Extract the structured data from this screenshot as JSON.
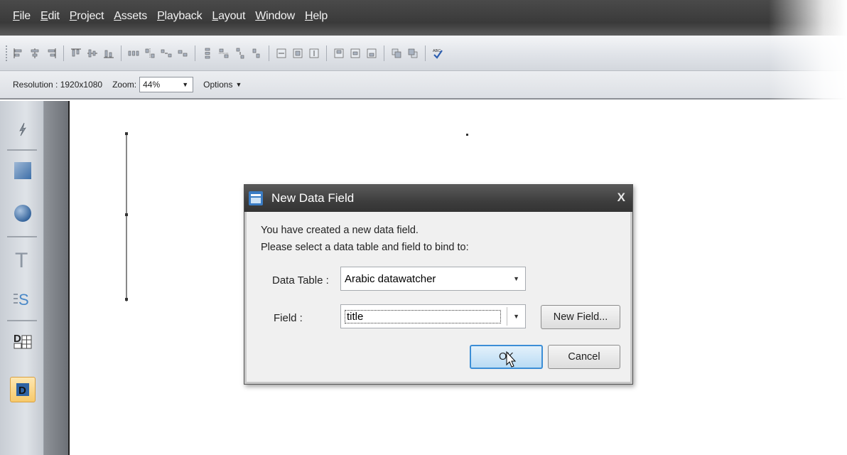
{
  "menu": {
    "items": [
      "File",
      "Edit",
      "Project",
      "Assets",
      "Playback",
      "Layout",
      "Window",
      "Help"
    ]
  },
  "toolbar": {
    "icons": [
      "align-left-icon",
      "align-center-icon",
      "align-right-icon",
      "align-top-icon",
      "align-middle-icon",
      "align-bottom-icon",
      "distribute-horizontal-icon",
      "distribute-h-center-icon",
      "distribute-h-spacing-icon",
      "distribute-h-right-icon",
      "distribute-vertical-icon",
      "distribute-v-center-icon",
      "distribute-v-spacing-icon",
      "distribute-v-bottom-icon",
      "same-width-icon",
      "same-size-icon",
      "same-height-icon",
      "center-horizontal-icon",
      "center-both-icon",
      "center-vertical-icon",
      "bring-front-icon",
      "send-back-icon",
      "spellcheck-icon"
    ]
  },
  "options_bar": {
    "resolution_label": "Resolution : 1920x1080",
    "zoom_label": "Zoom:",
    "zoom_value": "44%",
    "options_label": "Options"
  },
  "tools": [
    "select-tool-icon",
    "rectangle-tool-icon",
    "ellipse-tool-icon",
    "text-tool-icon",
    "scroll-text-tool-icon",
    "data-table-tool-icon",
    "data-field-tool-icon"
  ],
  "dialog": {
    "title": "New Data Field",
    "close_label": "X",
    "message_line1": "You have created a new data field.",
    "message_line2": "Please select a data table and field to bind to:",
    "data_table_label": "Data Table :",
    "data_table_value": "Arabic datawatcher",
    "field_label": "Field :",
    "field_value": "title",
    "new_field_button": "New Field...",
    "ok_button": "OK",
    "cancel_button": "Cancel"
  },
  "colors": {
    "menubar": "#3e3e3e",
    "dialog_title": "#3e3e3e",
    "ok_border": "#3c8ed6",
    "active_tool": "#f7c96a"
  }
}
